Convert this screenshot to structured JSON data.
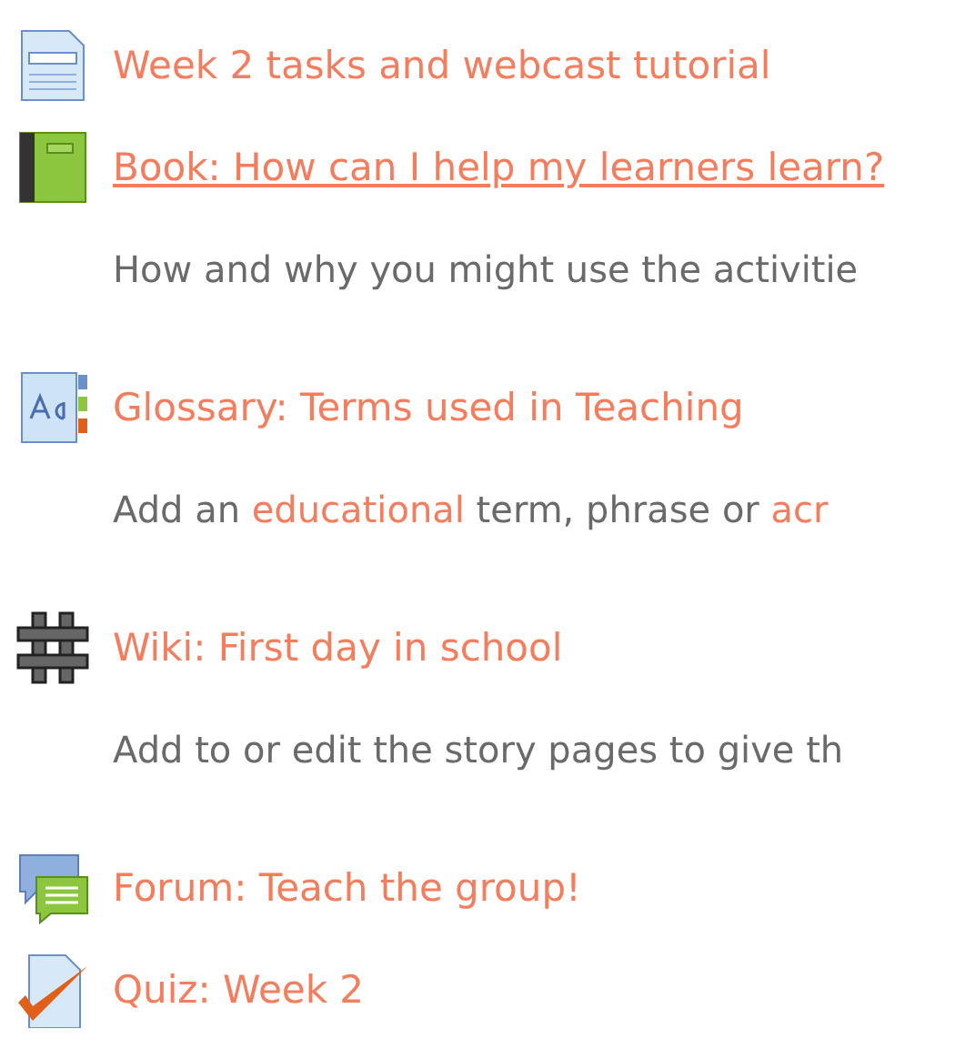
{
  "activities": [
    {
      "kind": "page",
      "title": "Week 2 tasks and webcast tutorial",
      "underlined": false
    },
    {
      "kind": "book",
      "title": "Book: How can I help my learners learn?",
      "underlined": true,
      "description": [
        {
          "text": "How and why you might use the activitie",
          "link": false
        }
      ]
    },
    {
      "kind": "glossary",
      "title": "Glossary: Terms used in Teaching",
      "underlined": false,
      "description": [
        {
          "text": "Add an ",
          "link": false
        },
        {
          "text": "educational",
          "link": true
        },
        {
          "text": " term, phrase or ",
          "link": false
        },
        {
          "text": "acr",
          "link": true
        }
      ]
    },
    {
      "kind": "wiki",
      "title": "Wiki: First day in school",
      "underlined": false,
      "description": [
        {
          "text": "Add to or edit the story pages to give th",
          "link": false
        }
      ]
    },
    {
      "kind": "forum",
      "title": "Forum: Teach the group!",
      "underlined": false
    },
    {
      "kind": "quiz",
      "title": "Quiz: Week 2",
      "underlined": false
    }
  ]
}
